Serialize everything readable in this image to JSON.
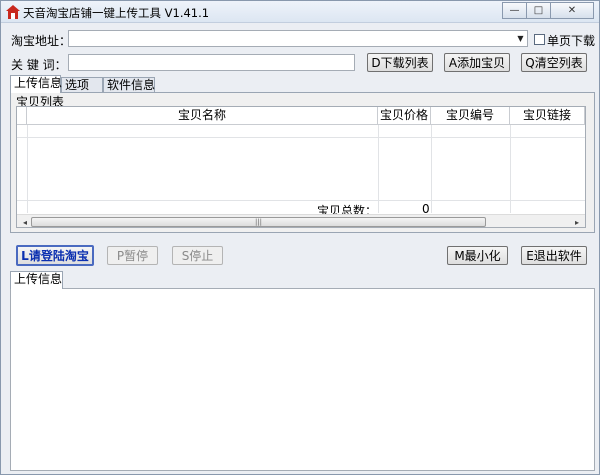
{
  "window": {
    "title": "天音淘宝店铺一键上传工具 V1.41.1",
    "minimize_glyph": "—",
    "maximize_glyph": "□",
    "close_glyph": "✕"
  },
  "form": {
    "url_label": "淘宝地址：",
    "url_value": "",
    "single_page_label": "单页下载",
    "keyword_label": "关 键 词：",
    "keyword_value": ""
  },
  "buttons": {
    "download_list": "D下载列表",
    "add_item": "A添加宝贝",
    "clear_list": "Q清空列表",
    "login": "L请登陆淘宝",
    "pause": "P暂停",
    "stop": "S停止",
    "minimize": "M最小化",
    "exit": "E退出软件"
  },
  "tabs": [
    "上传信息",
    "选项",
    "软件信息"
  ],
  "item_group": {
    "title": "宝贝列表",
    "columns": [
      "宝贝名称",
      "宝贝价格",
      "宝贝编号",
      "宝贝链接"
    ],
    "total_label": "宝贝总数：",
    "total_value": "0"
  },
  "log_tab": "上传信息",
  "scrollbar": {
    "left_arrow": "◂",
    "right_arrow": "▸",
    "thumb_grip": "|||"
  },
  "colors": {
    "accent": "#0a2fb0",
    "window_bg": "#ebeef3"
  },
  "icons": {
    "app": "house-icon",
    "combo": "chevron-down-icon"
  }
}
